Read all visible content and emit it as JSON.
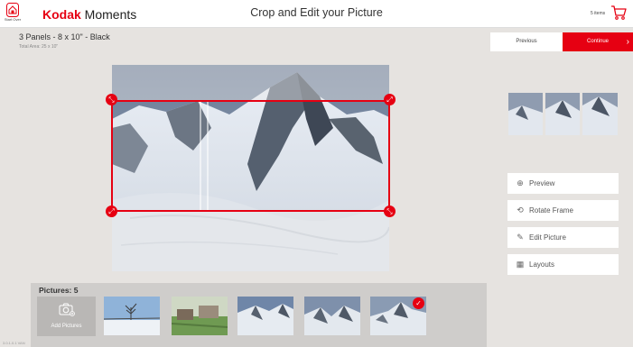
{
  "header": {
    "home_label": "Start Over",
    "brand_bold": "Kodak",
    "brand_rest": " Moments",
    "title": "Crop and Edit your Picture",
    "cart_count": "5 items"
  },
  "product": {
    "name": "3 Panels - 8 x 10\" - Black",
    "area": "Total Area: 25 x 10\""
  },
  "nav": {
    "previous": "Previous",
    "continue": "Continue",
    "continue_arrow": "›"
  },
  "tools": [
    {
      "label": "Preview",
      "icon": "⊕"
    },
    {
      "label": "Rotate Frame",
      "icon": "⟲"
    },
    {
      "label": "Edit Picture",
      "icon": "✎"
    },
    {
      "label": "Layouts",
      "icon": "▦"
    }
  ],
  "tray": {
    "title": "Pictures: 5",
    "add_label": "Add Pictures",
    "check_mark": "✓"
  },
  "version": "3.0.1.0.1 VAN",
  "colors": {
    "accent": "#e60012",
    "background": "#e6e3e0"
  }
}
